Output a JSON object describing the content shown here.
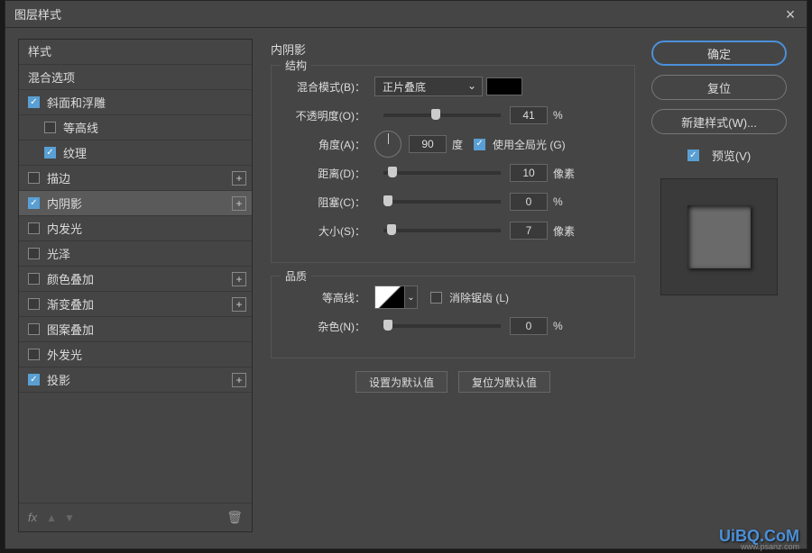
{
  "title": "图层样式",
  "left": {
    "header": "样式",
    "blend_options": "混合选项",
    "items": [
      {
        "label": "斜面和浮雕",
        "checked": true,
        "indent": false,
        "plus": false
      },
      {
        "label": "等高线",
        "checked": false,
        "indent": true,
        "plus": false
      },
      {
        "label": "纹理",
        "checked": true,
        "indent": true,
        "plus": false
      },
      {
        "label": "描边",
        "checked": false,
        "indent": false,
        "plus": true
      },
      {
        "label": "内阴影",
        "checked": true,
        "indent": false,
        "plus": true,
        "selected": true
      },
      {
        "label": "内发光",
        "checked": false,
        "indent": false,
        "plus": false
      },
      {
        "label": "光泽",
        "checked": false,
        "indent": false,
        "plus": false
      },
      {
        "label": "颜色叠加",
        "checked": false,
        "indent": false,
        "plus": true
      },
      {
        "label": "渐变叠加",
        "checked": false,
        "indent": false,
        "plus": true
      },
      {
        "label": "图案叠加",
        "checked": false,
        "indent": false,
        "plus": false
      },
      {
        "label": "外发光",
        "checked": false,
        "indent": false,
        "plus": false
      },
      {
        "label": "投影",
        "checked": true,
        "indent": false,
        "plus": true
      }
    ],
    "fx": "fx"
  },
  "mid": {
    "title": "内阴影",
    "group1": "结构",
    "group2": "品质",
    "blend_mode_label": "混合模式(B)：",
    "blend_mode_value": "正片叠底",
    "opacity_label": "不透明度(O)：",
    "opacity_value": "41",
    "angle_label": "角度(A)：",
    "angle_value": "90",
    "angle_unit": "度",
    "global_light": "使用全局光 (G)",
    "distance_label": "距离(D)：",
    "distance_value": "10",
    "px": "像素",
    "choke_label": "阻塞(C)：",
    "choke_value": "0",
    "size_label": "大小(S)：",
    "size_value": "7",
    "contour_label": "等高线：",
    "antialias": "消除锯齿 (L)",
    "noise_label": "杂色(N)：",
    "noise_value": "0",
    "pct": "%",
    "set_default": "设置为默认值",
    "reset_default": "复位为默认值"
  },
  "right": {
    "ok": "确定",
    "cancel": "复位",
    "new_style": "新建样式(W)...",
    "preview": "预览(V)"
  },
  "watermark": "UiBQ.CoM",
  "watermark2": "www.psanz.com",
  "chart_data": {
    "type": "table",
    "title": "内阴影 (Inner Shadow) settings",
    "rows": [
      {
        "param": "混合模式",
        "value": "正片叠底"
      },
      {
        "param": "不透明度",
        "value": 41,
        "unit": "%"
      },
      {
        "param": "角度",
        "value": 90,
        "unit": "度"
      },
      {
        "param": "使用全局光",
        "value": true
      },
      {
        "param": "距离",
        "value": 10,
        "unit": "像素"
      },
      {
        "param": "阻塞",
        "value": 0,
        "unit": "%"
      },
      {
        "param": "大小",
        "value": 7,
        "unit": "像素"
      },
      {
        "param": "消除锯齿",
        "value": false
      },
      {
        "param": "杂色",
        "value": 0,
        "unit": "%"
      }
    ]
  }
}
